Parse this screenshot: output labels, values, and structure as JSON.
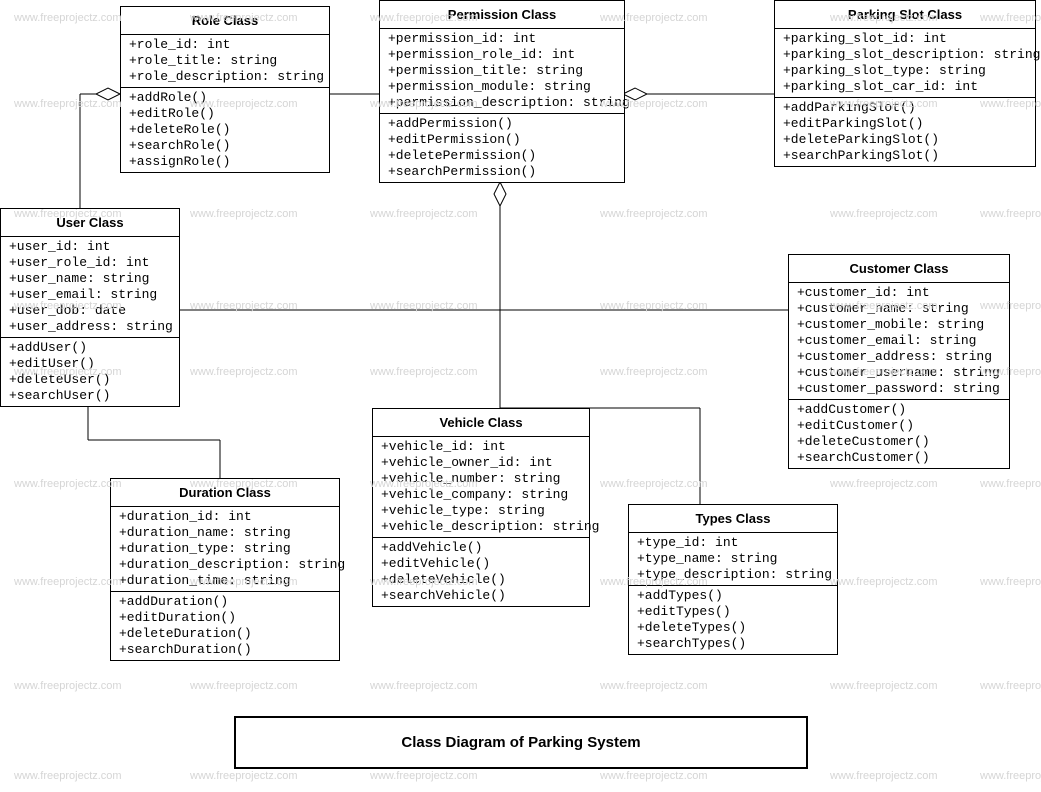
{
  "diagram_title": "Class Diagram of Parking System",
  "watermark_text": "www.freeprojectz.com",
  "classes": {
    "role": {
      "name": "Role Class",
      "attributes": [
        "+role_id: int",
        "+role_title: string",
        "+role_description: string"
      ],
      "methods": [
        "+addRole()",
        "+editRole()",
        "+deleteRole()",
        "+searchRole()",
        "+assignRole()"
      ]
    },
    "permission": {
      "name": "Permission Class",
      "attributes": [
        "+permission_id: int",
        "+permission_role_id: int",
        "+permission_title: string",
        "+permission_module: string",
        "+permission_description: string"
      ],
      "methods": [
        "+addPermission()",
        "+editPermission()",
        "+deletePermission()",
        "+searchPermission()"
      ]
    },
    "parkingslot": {
      "name": "Parking Slot Class",
      "attributes": [
        "+parking_slot_id: int",
        "+parking_slot_description: string",
        "+parking_slot_type: string",
        "+parking_slot_car_id: int"
      ],
      "methods": [
        "+addParkingSlot()",
        "+editParkingSlot()",
        "+deleteParkingSlot()",
        "+searchParkingSlot()"
      ]
    },
    "user": {
      "name": "User Class",
      "attributes": [
        "+user_id: int",
        "+user_role_id: int",
        "+user_name: string",
        "+user_email: string",
        "+user_dob: date",
        "+user_address: string"
      ],
      "methods": [
        "+addUser()",
        "+editUser()",
        "+deleteUser()",
        "+searchUser()"
      ]
    },
    "customer": {
      "name": "Customer Class",
      "attributes": [
        "+customer_id: int",
        "+customer_name: string",
        "+customer_mobile: string",
        "+customer_email: string",
        "+customer_address: string",
        "+customer_username: string",
        "+customer_password: string"
      ],
      "methods": [
        "+addCustomer()",
        "+editCustomer()",
        "+deleteCustomer()",
        "+searchCustomer()"
      ]
    },
    "duration": {
      "name": "Duration Class",
      "attributes": [
        "+duration_id: int",
        "+duration_name: string",
        "+duration_type: string",
        "+duration_description: string",
        "+duration_time: string"
      ],
      "methods": [
        "+addDuration()",
        "+editDuration()",
        "+deleteDuration()",
        "+searchDuration()"
      ]
    },
    "vehicle": {
      "name": "Vehicle Class",
      "attributes": [
        "+vehicle_id: int",
        "+vehicle_owner_id: int",
        "+vehicle_number: string",
        "+vehicle_company: string",
        "+vehicle_type: string",
        "+vehicle_description: string"
      ],
      "methods": [
        "+addVehicle()",
        "+editVehicle()",
        "+deleteVehicle()",
        "+searchVehicle()"
      ]
    },
    "types": {
      "name": "Types Class",
      "attributes": [
        "+type_id: int",
        "+type_name: string",
        "+type_description: string"
      ],
      "methods": [
        "+addTypes()",
        "+editTypes()",
        "+deleteTypes()",
        "+searchTypes()"
      ]
    }
  }
}
